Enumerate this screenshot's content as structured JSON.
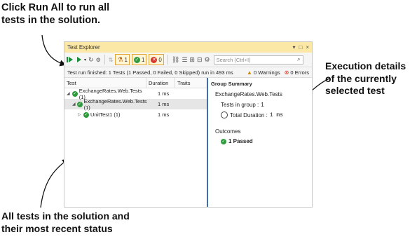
{
  "callouts": {
    "run_all": "Click Run All to run all tests in the solution.",
    "execution": "Execution details of the currently selected test",
    "status": "All tests in the solution and their most recent status"
  },
  "window": {
    "title": "Test Explorer",
    "title_icons": [
      "▾",
      "□",
      "×"
    ]
  },
  "toolbar": {
    "filter_flask_count": "1",
    "filter_passed_count": "1",
    "filter_failed_count": "0",
    "search_placeholder": "Search (Ctrl+I)"
  },
  "status": {
    "message": "Test run finished: 1 Tests (1 Passed, 0 Failed, 0 Skipped) run in 493 ms",
    "warnings": "0 Warnings",
    "errors": "0 Errors"
  },
  "columns": {
    "test": "Test",
    "duration": "Duration",
    "traits": "Traits"
  },
  "tests": [
    {
      "name": "ExchangeRates.Web.Tests (1)",
      "duration": "1 ms"
    },
    {
      "name": "ExchangeRates.Web.Tests (1)",
      "duration": "1 ms"
    },
    {
      "name": "UnitTest1 (1)",
      "duration": "1 ms"
    }
  ],
  "summary": {
    "title": "Group Summary",
    "name": "ExchangeRates.Web.Tests",
    "tests_in_group_label": "Tests in group :",
    "tests_in_group_value": "1",
    "total_duration_label": "Total Duration :",
    "total_duration_value": "1 ms",
    "outcomes_label": "Outcomes",
    "passed": "1 Passed"
  },
  "colors": {
    "accent": "#3c6fb5",
    "passed": "#2e9b3d",
    "failed": "#d9342b",
    "titlebar": "#fbe8a7"
  }
}
